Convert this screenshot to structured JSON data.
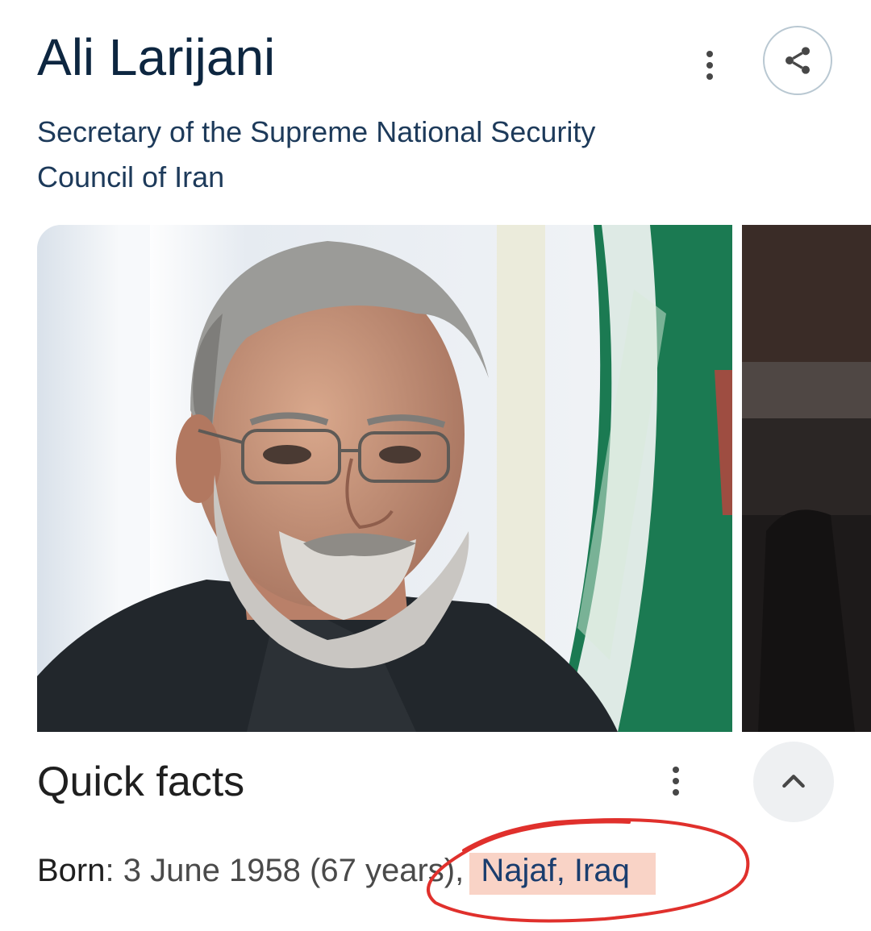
{
  "entity": {
    "name": "Ali Larijani",
    "description": "Secretary of the Supreme National Security Council of Iran"
  },
  "icons": {
    "more": "more-vert-icon",
    "share": "share-icon",
    "collapse": "chevron-up-icon"
  },
  "images": {
    "main": "portrait of a grey-haired bearded man wearing glasses in front of a green, white and red flag",
    "secondary": "partially visible dark photo"
  },
  "quick_facts": {
    "title": "Quick facts",
    "born": {
      "label": "Born",
      "separator": ": ",
      "value": "3 June 1958 (67 years), ",
      "link": "Najaf, Iraq"
    }
  },
  "colors": {
    "title": "#0d2640",
    "link": "#1a3d6e",
    "highlight": "#f9d3c6",
    "annotation": "#e0302c",
    "flag_green": "#1b7a52"
  }
}
